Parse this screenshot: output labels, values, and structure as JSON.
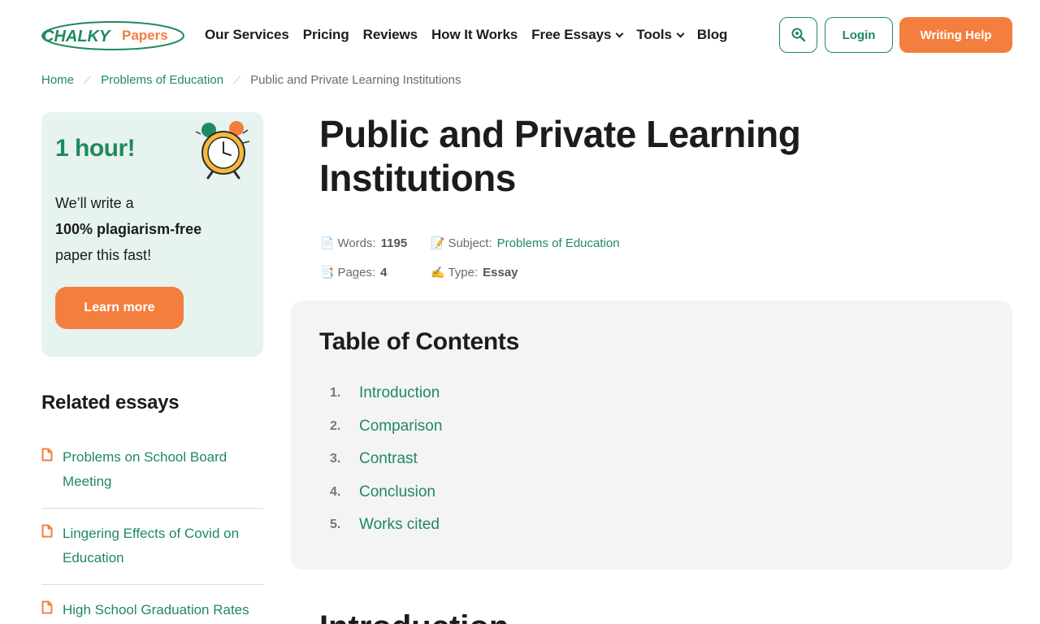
{
  "header": {
    "logo": {
      "word1": "CHALKY",
      "word2": "Papers"
    },
    "nav": [
      {
        "label": "Our Services",
        "dropdown": false
      },
      {
        "label": "Pricing",
        "dropdown": false
      },
      {
        "label": "Reviews",
        "dropdown": false
      },
      {
        "label": "How It Works",
        "dropdown": false
      },
      {
        "label": "Free Essays",
        "dropdown": true
      },
      {
        "label": "Tools",
        "dropdown": true
      },
      {
        "label": "Blog",
        "dropdown": false
      }
    ],
    "search_icon": "search-icon",
    "login_label": "Login",
    "help_label": "Writing Help"
  },
  "breadcrumb": {
    "home": "Home",
    "category": "Problems of Education",
    "current": "Public and Private Learning Institutions"
  },
  "promo": {
    "title": "1 hour!",
    "line1": "We’ll write a",
    "line2": "100% plagiarism-free",
    "line3": "paper this fast!",
    "button": "Learn more",
    "icon": "alarm-clock-icon"
  },
  "related": {
    "title": "Related essays",
    "items": [
      "Problems on School Board Meeting",
      "Lingering Effects of Covid on Education",
      "High School Graduation Rates"
    ]
  },
  "article": {
    "title": "Public and Private Learning Institutions",
    "meta": {
      "words_label": "Words:",
      "words": "1195",
      "subject_label": "Subject:",
      "subject": "Problems of Education",
      "pages_label": "Pages:",
      "pages": "4",
      "type_label": "Type:",
      "type": "Essay"
    },
    "toc": {
      "title": "Table of Contents",
      "items": [
        {
          "num": "1.",
          "label": "Introduction"
        },
        {
          "num": "2.",
          "label": "Comparison"
        },
        {
          "num": "3.",
          "label": "Contrast"
        },
        {
          "num": "4.",
          "label": "Conclusion"
        },
        {
          "num": "5.",
          "label": "Works cited"
        }
      ]
    },
    "section_title": "Introduction"
  },
  "colors": {
    "brand_green": "#1f8a5e",
    "brand_orange": "#f47e3e",
    "promo_bg": "#e7f3ee",
    "toc_bg": "#f4f4f4"
  }
}
